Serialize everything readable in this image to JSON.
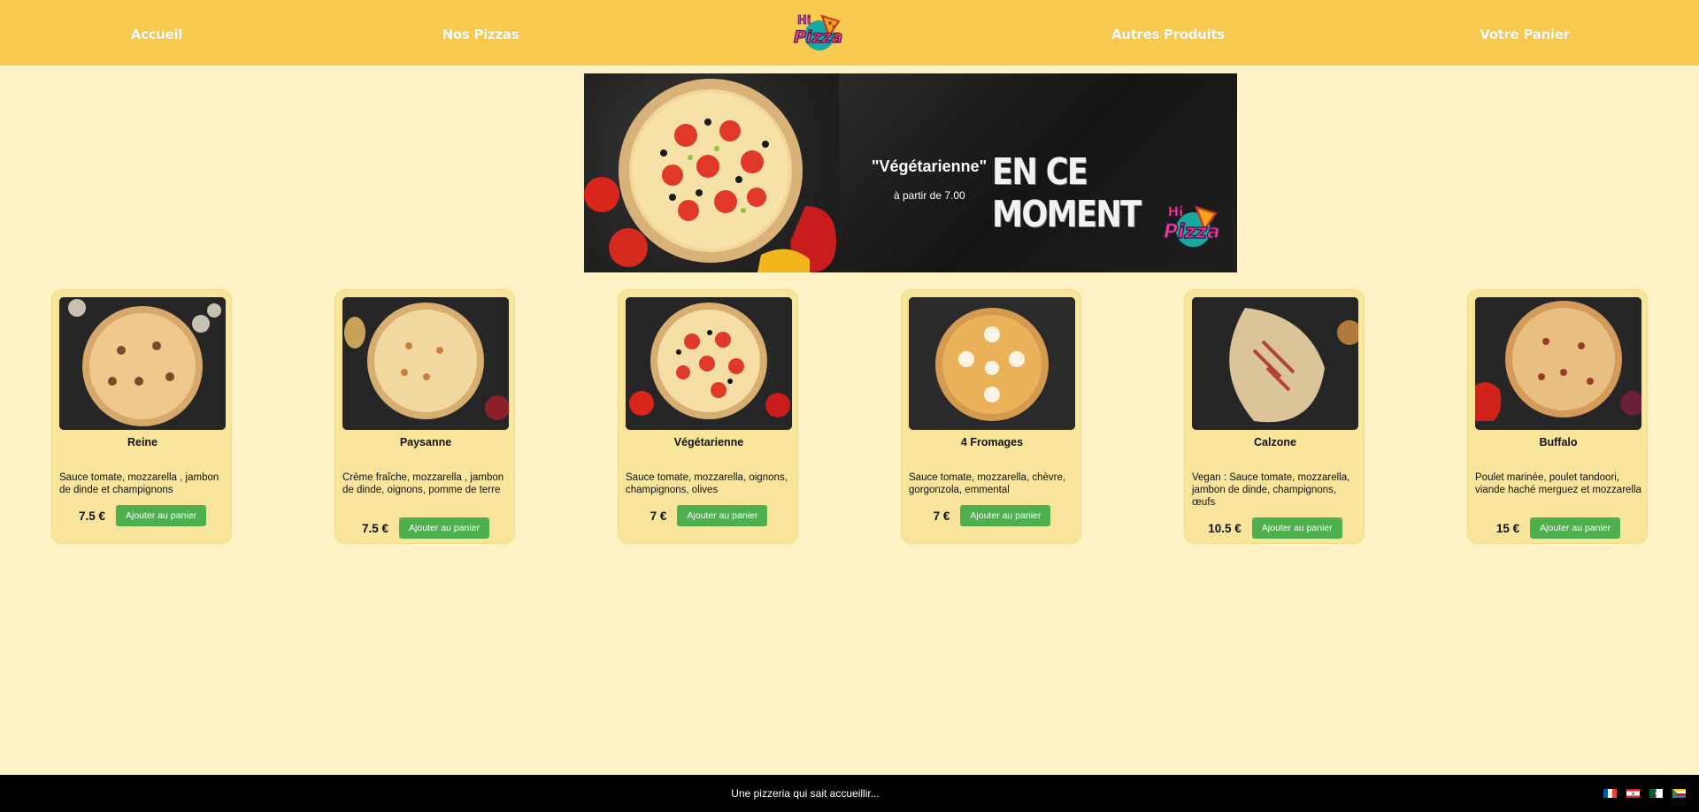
{
  "nav": {
    "home": "Accueil",
    "pizzas": "Nos Pizzas",
    "other_products": "Autres Produits",
    "cart": "Votre Panier",
    "logo_text": "Hi Pizza"
  },
  "banner": {
    "pizza_name": "\"Végétarienne\"",
    "headline": "EN CE MOMENT",
    "price_text": "à partir de 7.00"
  },
  "products": [
    {
      "name": "Reine",
      "description": "Sauce tomate, mozzarella , jambon de dinde et champignons",
      "price": "7.5 €",
      "button": "Ajouter au panier",
      "image_icon": "pizza-image"
    },
    {
      "name": "Paysanne",
      "description": "Crème fraîche, mozzarella , jambon de dinde, oignons, pomme de terre",
      "price": "7.5 €",
      "button": "Ajouter au panier",
      "image_icon": "pizza-image"
    },
    {
      "name": "Végétarienne",
      "description": "Sauce tomate, mozzarella, oignons, champignons, olives",
      "price": "7 €",
      "button": "Ajouter au panier",
      "image_icon": "pizza-image"
    },
    {
      "name": "4 Fromages",
      "description": "Sauce tomate, mozzarella, chèvre, gorgonzola, emmental",
      "price": "7 €",
      "button": "Ajouter au panier",
      "image_icon": "pizza-image"
    },
    {
      "name": "Calzone",
      "description": "Vegan : Sauce tomate, mozzarella, jambon de dinde, champignons, œufs",
      "price": "10.5 €",
      "button": "Ajouter au panier",
      "image_icon": "calzone-image"
    },
    {
      "name": "Buffalo",
      "description": "Poulet marinée, poulet tandoori, viande haché merguez et mozzarella",
      "price": "15 €",
      "button": "Ajouter au panier",
      "image_icon": "pizza-image"
    }
  ],
  "footer": {
    "tagline": "Une pizzeria qui sait accueillir...",
    "flags": [
      "france-flag-icon",
      "lebanon-flag-icon",
      "algeria-flag-icon",
      "comoros-flag-icon"
    ]
  },
  "colors": {
    "header": "#f8ca50",
    "page": "#fff2c6",
    "card": "#f8e49b",
    "button": "#4daf4e",
    "footer": "#000000"
  }
}
